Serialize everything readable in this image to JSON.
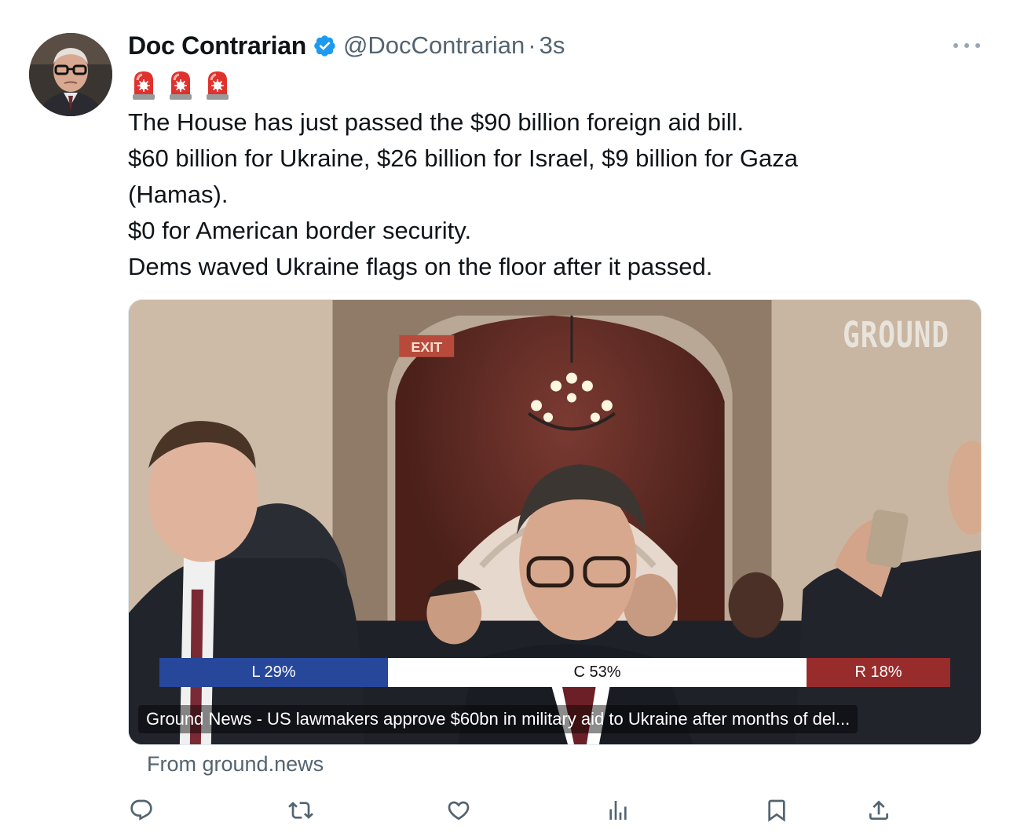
{
  "author": {
    "display_name": "Doc Contrarian",
    "handle": "@DocContrarian",
    "separator": "·",
    "timestamp": "3s",
    "verified": true,
    "verified_color": "#1d9bf0"
  },
  "tweet": {
    "emojis": [
      "siren",
      "siren",
      "siren"
    ],
    "lines": [
      "The House has just passed the $90 billion foreign aid bill.",
      "$60 billion for Ukraine, $26 billion for Israel, $9 billion for Gaza",
      "(Hamas).",
      "$0 for American border security.",
      "Dems waved Ukraine flags on the floor after it passed."
    ]
  },
  "card": {
    "logo_text": "GROUND",
    "bias": {
      "left_label": "L 29%",
      "center_label": "C 53%",
      "right_label": "R 18%",
      "left_share": 0.29,
      "center_share": 0.53,
      "right_share": 0.18,
      "left_color": "#27479a",
      "center_color": "#ffffff",
      "right_color": "#982c2c"
    },
    "caption": "Ground News - US lawmakers approve $60bn in military aid to Ukraine after months of del...",
    "source": "From ground.news"
  },
  "actions": {
    "icons": [
      "reply-icon",
      "retweet-icon",
      "like-icon",
      "views-icon",
      "bookmark-icon",
      "share-icon"
    ]
  },
  "colors": {
    "text_primary": "#0f1419",
    "text_secondary": "#536471",
    "icon_gray": "#536471"
  }
}
